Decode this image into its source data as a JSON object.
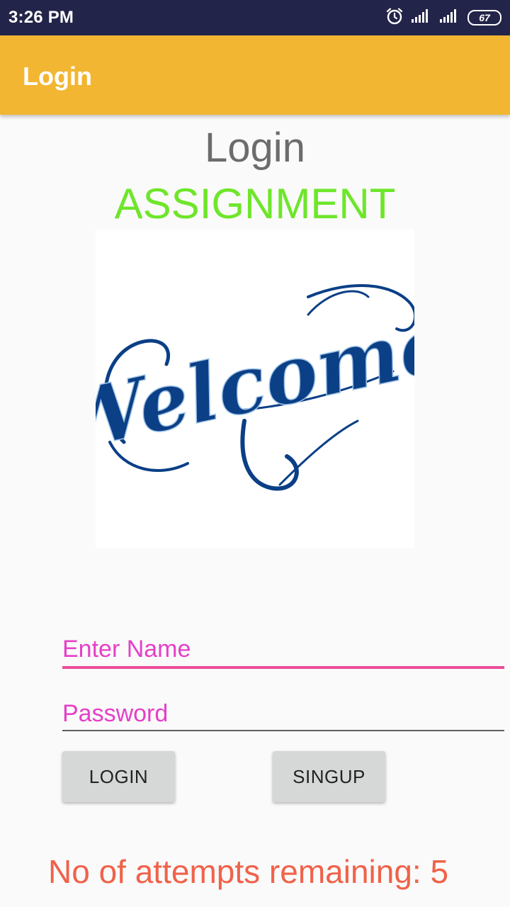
{
  "status_bar": {
    "time": "3:26 PM",
    "battery_level": "67",
    "icons": [
      "alarm-icon",
      "signal-icon",
      "signal-icon",
      "battery-icon"
    ]
  },
  "app_bar": {
    "title": "Login"
  },
  "main": {
    "heading": "Login",
    "subheading": "ASSIGNMENT",
    "image_text": "Welcome",
    "name_field": {
      "placeholder": "Enter Name",
      "value": ""
    },
    "password_field": {
      "placeholder": "Password",
      "value": ""
    },
    "login_button": "LOGIN",
    "signup_button": "SINGUP",
    "attempts_text": "No of attempts remaining: 5"
  },
  "colors": {
    "status_bar": "#232449",
    "app_bar": "#f2b633",
    "heading": "#6c6c6c",
    "subheading": "#6ee62a",
    "placeholder": "#e53fc8",
    "focused_underline": "#ec4d9a",
    "attempts": "#f0624a",
    "welcome_script": "#0b3f86"
  }
}
